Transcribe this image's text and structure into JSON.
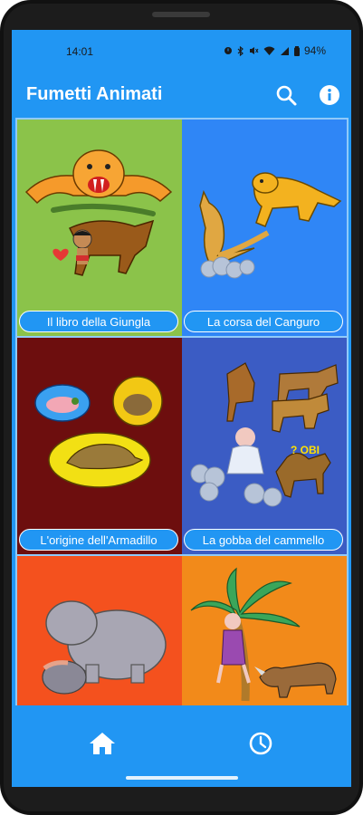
{
  "status_bar": {
    "time": "14:01",
    "battery": "94%"
  },
  "app_bar": {
    "title": "Fumetti Animati",
    "search_icon": "search-icon",
    "info_icon": "info-icon"
  },
  "stories": [
    {
      "label": "Il libro della Giungla",
      "bg": "#8bc34a"
    },
    {
      "label": "La corsa del Canguro",
      "bg": "#2f86f6"
    },
    {
      "label": "L'origine dell'Armadillo",
      "bg": "#6d0e0e"
    },
    {
      "label": "La gobba del cammello",
      "bg": "#3b5cc4"
    },
    {
      "label": "",
      "bg": "#f4511e"
    },
    {
      "label": "",
      "bg": "#f28a1a"
    }
  ],
  "bottom_nav": {
    "home_icon": "home-icon",
    "history_icon": "clock-icon"
  },
  "colors": {
    "primary": "#2196f3",
    "grid_bg": "#90caf9"
  }
}
